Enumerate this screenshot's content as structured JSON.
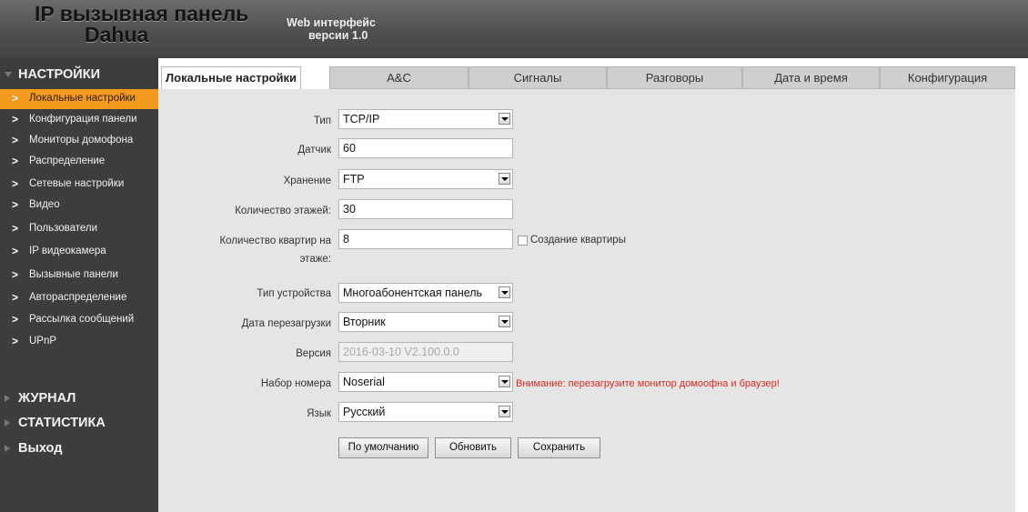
{
  "header": {
    "title_line1": "IP вызывная панель",
    "title_line2": "Dahua",
    "web_line1": "Web интерфейс",
    "web_line2": "версии 1.0"
  },
  "sidebar": {
    "section_settings": "НАСТРОЙКИ",
    "items": [
      {
        "label": "Локальные настройки",
        "active": true
      },
      {
        "label": "Конфигурация панели"
      },
      {
        "label": "Мониторы домофона"
      },
      {
        "label": "Распределение"
      },
      {
        "label": "Сетевые настройки"
      },
      {
        "label": "Видео"
      },
      {
        "label": "Пользователи"
      },
      {
        "label": "IP видеокамера"
      },
      {
        "label": "Вызывные панели"
      },
      {
        "label": "Автораспределение"
      },
      {
        "label": "Рассылка сообщений"
      },
      {
        "label": "UPnP"
      }
    ],
    "section_journal": "ЖУРНАЛ",
    "section_stats": "СТАТИСТИКА",
    "section_exit": "Выход"
  },
  "tabs": [
    {
      "label": "Локальные настройки",
      "active": true
    },
    {
      "label": "A&C"
    },
    {
      "label": "Сигналы"
    },
    {
      "label": "Разговоры"
    },
    {
      "label": "Дата и время"
    },
    {
      "label": "Конфигурация"
    }
  ],
  "form": {
    "type_label": "Тип",
    "type_value": "TCP/IP",
    "sensor_label": "Датчик",
    "sensor_value": "60",
    "storage_label": "Хранение",
    "storage_value": "FTP",
    "floors_label": "Количество этажей:",
    "floors_value": "30",
    "apts_label_line1": "Количество квартир на",
    "apts_label_line2": "этаже:",
    "apts_value": "8",
    "create_apt_label": "Создание квартиры",
    "create_apt_checked": false,
    "device_type_label": "Тип устройства",
    "device_type_value": "Многоабонентская панель",
    "reboot_label": "Дата перезагрузки",
    "reboot_value": "Вторник",
    "version_label": "Версия",
    "version_value": "2016-03-10 V2.100.0.0",
    "dial_label": "Набор номера",
    "dial_value": "Noserial",
    "warning": "Внимание: перезагрузите монитор домоофна и браузер!",
    "language_label": "Язык",
    "language_value": "Русский"
  },
  "buttons": {
    "default": "По умолчанию",
    "refresh": "Обновить",
    "save": "Сохранить"
  },
  "colors": {
    "active_nav": "#f39a1c",
    "sidebar_bg": "#3d3d3d",
    "content_bg": "#e5e5e5",
    "warning": "#e2261c"
  }
}
